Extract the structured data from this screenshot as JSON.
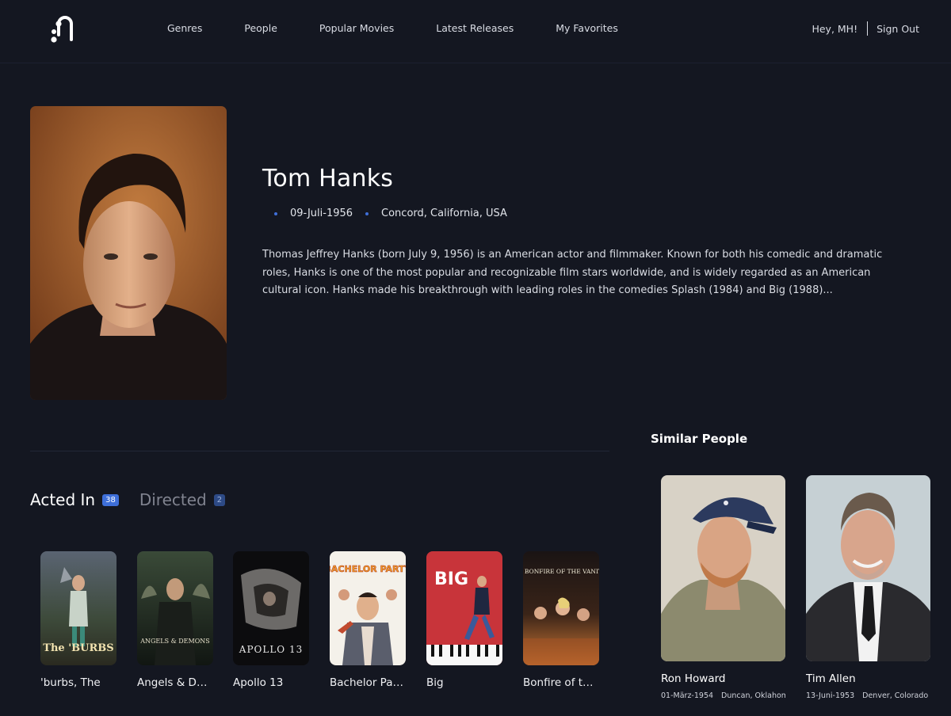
{
  "nav": {
    "links": [
      "Genres",
      "People",
      "Popular Movies",
      "Latest Releases",
      "My Favorites"
    ],
    "greeting": "Hey, MH!",
    "signout": "Sign Out"
  },
  "person": {
    "name": "Tom Hanks",
    "birthdate": "09-Juli-1956",
    "birthplace": "Concord, California, USA",
    "bio": "Thomas Jeffrey Hanks (born July 9, 1956) is an American actor and filmmaker. Known for both his comedic and dramatic roles, Hanks is one of the most popular and recognizable film stars worldwide, and is widely regarded as an American cultural icon. Hanks made his breakthrough with leading roles in the comedies Splash (1984) and Big (1988)..."
  },
  "tabs": [
    {
      "label": "Acted In",
      "count": "38"
    },
    {
      "label": "Directed",
      "count": "2"
    }
  ],
  "movies": [
    {
      "title": "'burbs, The",
      "poster_text": "The 'BURBS"
    },
    {
      "title": "Angels & Demons",
      "poster_text": "ANGELS & DEMONS"
    },
    {
      "title": "Apollo 13",
      "poster_text": "APOLLO 13"
    },
    {
      "title": "Bachelor Party",
      "poster_text": "BACHELOR PARTY"
    },
    {
      "title": "Big",
      "poster_text": "BIG"
    },
    {
      "title": "Bonfire of the Vanities",
      "poster_text": "THE BONFIRE OF THE VANITIES"
    }
  ],
  "similar": {
    "title": "Similar People",
    "people": [
      {
        "name": "Ron Howard",
        "birthdate": "01-März-1954",
        "birthplace": "Duncan, Oklahoma"
      },
      {
        "name": "Tim Allen",
        "birthdate": "13-Juni-1953",
        "birthplace": "Denver, Colorado"
      }
    ]
  },
  "colors": {
    "background": "#141721",
    "accent": "#3e6fd9"
  }
}
